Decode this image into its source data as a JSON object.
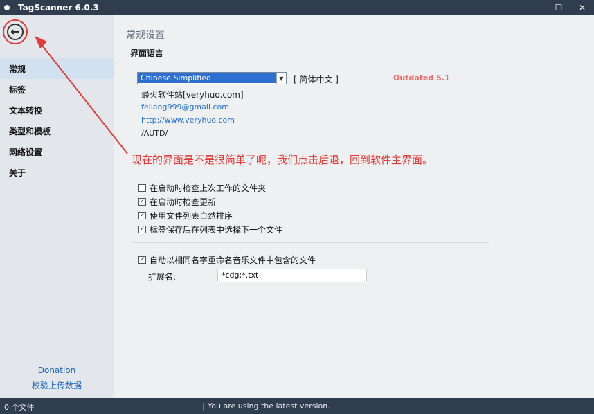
{
  "window": {
    "title": "TagScanner 6.0.3",
    "minimize": "—",
    "maximize": "☐",
    "close": "✕"
  },
  "sidebar": {
    "back_icon": "←",
    "items": [
      {
        "label": "常规",
        "active": true
      },
      {
        "label": "标签",
        "active": false
      },
      {
        "label": "文本转换",
        "active": false
      },
      {
        "label": "类型和模板",
        "active": false
      },
      {
        "label": "网络设置",
        "active": false
      },
      {
        "label": "关于",
        "active": false
      }
    ],
    "donation": "Donation",
    "upload": "校验上传数据"
  },
  "main": {
    "page_title": "常规设置",
    "section_title": "界面语言",
    "language": {
      "selected": "Chinese Simplified",
      "native": "[ 简体中文 ]",
      "status": "Outdated 5.1"
    },
    "translator": {
      "name": "最火软件站[veryhuo.com]",
      "email": "feilang999@gmail.com",
      "url": "http://www.veryhuo.com",
      "param": "/AUTD/"
    },
    "annotation": "现在的界面是不是很简单了呢，我们点击后退，回到软件主界面。",
    "options": [
      {
        "label": "在启动时检查上次工作的文件夹",
        "checked": false
      },
      {
        "label": "在启动时检查更新",
        "checked": true
      },
      {
        "label": "使用文件列表自然排序",
        "checked": true
      },
      {
        "label": "标签保存后在列表中选择下一个文件",
        "checked": true
      }
    ],
    "auto_rename": {
      "label": "自动以相同名字重命名音乐文件中包含的文件",
      "checked": true
    },
    "extensions": {
      "label": "扩展名:",
      "value": "*cdg;*.txt"
    }
  },
  "status": {
    "left": "0 个文件",
    "separator": "|",
    "right": "You are using the latest version."
  },
  "colors": {
    "annotation_red": "#e53935",
    "title_bar": "#2f3d4e",
    "selection_blue": "#2f6fd1",
    "outdated": "#f06a6a",
    "link_blue": "#1e6fd0"
  }
}
